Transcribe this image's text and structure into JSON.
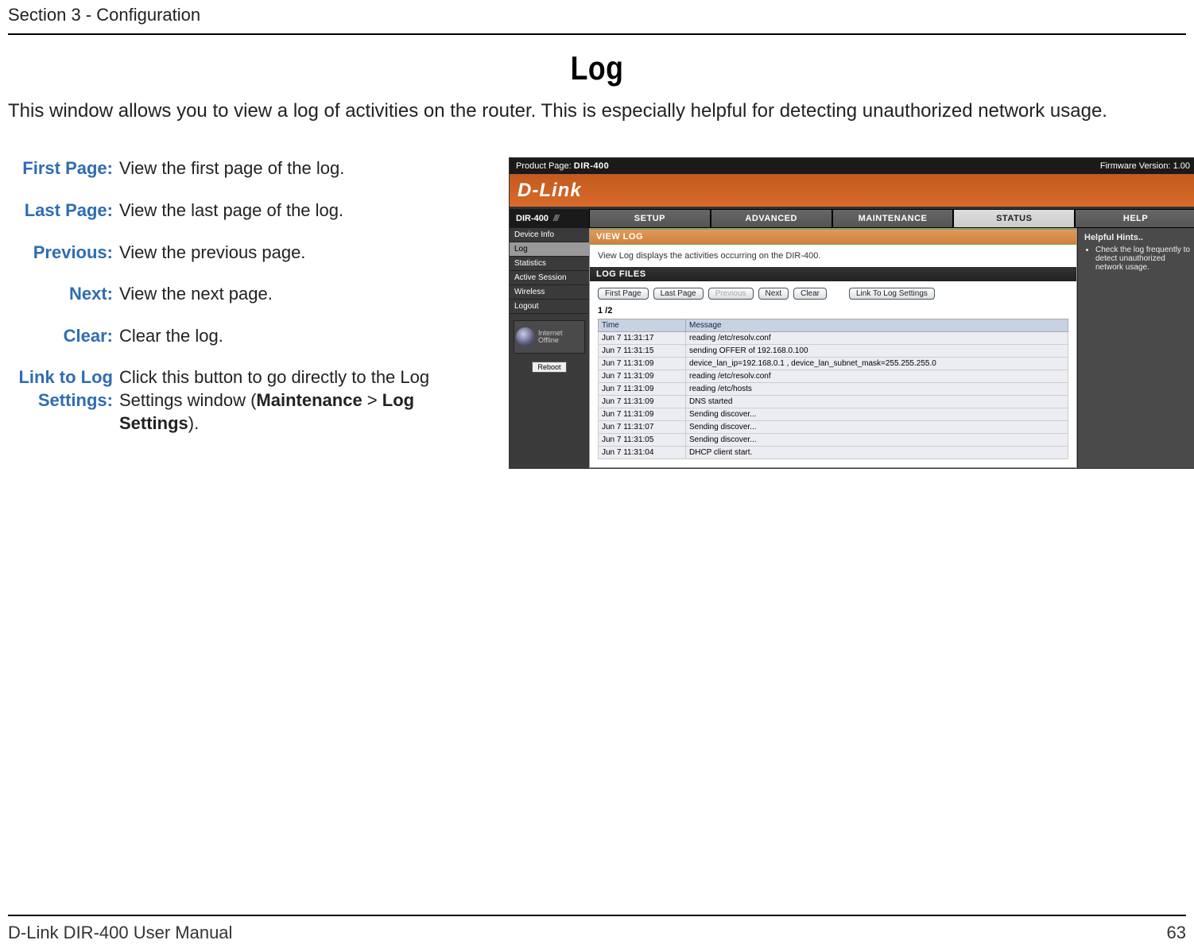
{
  "header": {
    "section_label": "Section 3 - Configuration",
    "page_title": "Log",
    "intro": "This window allows you to view a log of activities on the router. This is especially helpful for detecting unauthorized network usage."
  },
  "definitions": [
    {
      "term": "First Page:",
      "desc": "View the first page of the log."
    },
    {
      "term": "Last Page:",
      "desc": "View the last page of the log."
    },
    {
      "term": "Previous:",
      "desc": "View the previous page."
    },
    {
      "term": "Next:",
      "desc": "View the next page."
    },
    {
      "term": "Clear:",
      "desc": "Clear the log."
    },
    {
      "term": "Link to Log Settings:",
      "desc_pre": "Click this button to go directly to the Log Settings window (",
      "bold1": "Maintenance",
      "mid": " > ",
      "bold2": "Log Settings",
      "desc_post": ")."
    }
  ],
  "screenshot": {
    "top": {
      "product_page": "Product Page:",
      "model_small": "DIR-400",
      "firmware": "Firmware Version: 1.00"
    },
    "logo": "D-Link",
    "nav_left": {
      "model": "DIR-400",
      "stripes": "///"
    },
    "tabs": [
      "SETUP",
      "ADVANCED",
      "MAINTENANCE",
      "STATUS",
      "HELP"
    ],
    "active_tab_index": 3,
    "sidebar": [
      "Device Info",
      "Log",
      "Statistics",
      "Active Session",
      "Wireless",
      "Logout"
    ],
    "sidebar_selected_index": 1,
    "globe": {
      "l1": "Internet",
      "l2": "Offline"
    },
    "reboot": "Reboot",
    "view_log": {
      "header": "VIEW LOG",
      "text": "View Log displays the activities occurring on the DIR-400."
    },
    "log_files": {
      "header": "LOG FILES",
      "buttons": [
        "First Page",
        "Last Page",
        "Previous",
        "Next",
        "Clear",
        "Link To Log Settings"
      ],
      "disabled_button_index": 2,
      "page_indicator": "1 /2",
      "columns": [
        "Time",
        "Message"
      ],
      "rows": [
        {
          "time": "Jun 7 11:31:17",
          "msg": "reading /etc/resolv.conf"
        },
        {
          "time": "Jun 7 11:31:15",
          "msg": "sending OFFER of 192.168.0.100"
        },
        {
          "time": "Jun 7 11:31:09",
          "msg": "device_lan_ip=192.168.0.1 , device_lan_subnet_mask=255.255.255.0"
        },
        {
          "time": "Jun 7 11:31:09",
          "msg": "reading /etc/resolv.conf"
        },
        {
          "time": "Jun 7 11:31:09",
          "msg": "reading /etc/hosts"
        },
        {
          "time": "Jun 7 11:31:09",
          "msg": "DNS started"
        },
        {
          "time": "Jun 7 11:31:09",
          "msg": "Sending discover..."
        },
        {
          "time": "Jun 7 11:31:07",
          "msg": "Sending discover..."
        },
        {
          "time": "Jun 7 11:31:05",
          "msg": "Sending discover..."
        },
        {
          "time": "Jun 7 11:31:04",
          "msg": "DHCP client start."
        }
      ]
    },
    "hints": {
      "title": "Helpful Hints..",
      "text": "Check the log frequently to detect unauthorized network usage."
    }
  },
  "footer": {
    "left": "D-Link DIR-400 User Manual",
    "right": "63"
  }
}
